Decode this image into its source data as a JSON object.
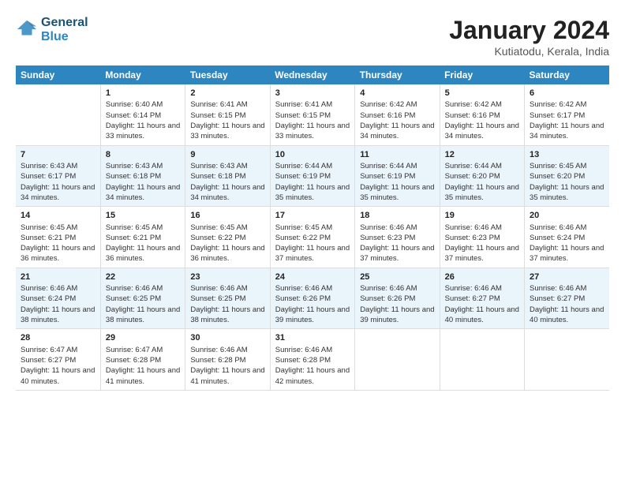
{
  "header": {
    "logo_line1": "General",
    "logo_line2": "Blue",
    "title": "January 2024",
    "subtitle": "Kutiatodu, Kerala, India"
  },
  "columns": [
    "Sunday",
    "Monday",
    "Tuesday",
    "Wednesday",
    "Thursday",
    "Friday",
    "Saturday"
  ],
  "rows": [
    [
      {
        "day": "",
        "sunrise": "",
        "sunset": "",
        "daylight": ""
      },
      {
        "day": "1",
        "sunrise": "Sunrise: 6:40 AM",
        "sunset": "Sunset: 6:14 PM",
        "daylight": "Daylight: 11 hours and 33 minutes."
      },
      {
        "day": "2",
        "sunrise": "Sunrise: 6:41 AM",
        "sunset": "Sunset: 6:15 PM",
        "daylight": "Daylight: 11 hours and 33 minutes."
      },
      {
        "day": "3",
        "sunrise": "Sunrise: 6:41 AM",
        "sunset": "Sunset: 6:15 PM",
        "daylight": "Daylight: 11 hours and 33 minutes."
      },
      {
        "day": "4",
        "sunrise": "Sunrise: 6:42 AM",
        "sunset": "Sunset: 6:16 PM",
        "daylight": "Daylight: 11 hours and 34 minutes."
      },
      {
        "day": "5",
        "sunrise": "Sunrise: 6:42 AM",
        "sunset": "Sunset: 6:16 PM",
        "daylight": "Daylight: 11 hours and 34 minutes."
      },
      {
        "day": "6",
        "sunrise": "Sunrise: 6:42 AM",
        "sunset": "Sunset: 6:17 PM",
        "daylight": "Daylight: 11 hours and 34 minutes."
      }
    ],
    [
      {
        "day": "7",
        "sunrise": "Sunrise: 6:43 AM",
        "sunset": "Sunset: 6:17 PM",
        "daylight": "Daylight: 11 hours and 34 minutes."
      },
      {
        "day": "8",
        "sunrise": "Sunrise: 6:43 AM",
        "sunset": "Sunset: 6:18 PM",
        "daylight": "Daylight: 11 hours and 34 minutes."
      },
      {
        "day": "9",
        "sunrise": "Sunrise: 6:43 AM",
        "sunset": "Sunset: 6:18 PM",
        "daylight": "Daylight: 11 hours and 34 minutes."
      },
      {
        "day": "10",
        "sunrise": "Sunrise: 6:44 AM",
        "sunset": "Sunset: 6:19 PM",
        "daylight": "Daylight: 11 hours and 35 minutes."
      },
      {
        "day": "11",
        "sunrise": "Sunrise: 6:44 AM",
        "sunset": "Sunset: 6:19 PM",
        "daylight": "Daylight: 11 hours and 35 minutes."
      },
      {
        "day": "12",
        "sunrise": "Sunrise: 6:44 AM",
        "sunset": "Sunset: 6:20 PM",
        "daylight": "Daylight: 11 hours and 35 minutes."
      },
      {
        "day": "13",
        "sunrise": "Sunrise: 6:45 AM",
        "sunset": "Sunset: 6:20 PM",
        "daylight": "Daylight: 11 hours and 35 minutes."
      }
    ],
    [
      {
        "day": "14",
        "sunrise": "Sunrise: 6:45 AM",
        "sunset": "Sunset: 6:21 PM",
        "daylight": "Daylight: 11 hours and 36 minutes."
      },
      {
        "day": "15",
        "sunrise": "Sunrise: 6:45 AM",
        "sunset": "Sunset: 6:21 PM",
        "daylight": "Daylight: 11 hours and 36 minutes."
      },
      {
        "day": "16",
        "sunrise": "Sunrise: 6:45 AM",
        "sunset": "Sunset: 6:22 PM",
        "daylight": "Daylight: 11 hours and 36 minutes."
      },
      {
        "day": "17",
        "sunrise": "Sunrise: 6:45 AM",
        "sunset": "Sunset: 6:22 PM",
        "daylight": "Daylight: 11 hours and 37 minutes."
      },
      {
        "day": "18",
        "sunrise": "Sunrise: 6:46 AM",
        "sunset": "Sunset: 6:23 PM",
        "daylight": "Daylight: 11 hours and 37 minutes."
      },
      {
        "day": "19",
        "sunrise": "Sunrise: 6:46 AM",
        "sunset": "Sunset: 6:23 PM",
        "daylight": "Daylight: 11 hours and 37 minutes."
      },
      {
        "day": "20",
        "sunrise": "Sunrise: 6:46 AM",
        "sunset": "Sunset: 6:24 PM",
        "daylight": "Daylight: 11 hours and 37 minutes."
      }
    ],
    [
      {
        "day": "21",
        "sunrise": "Sunrise: 6:46 AM",
        "sunset": "Sunset: 6:24 PM",
        "daylight": "Daylight: 11 hours and 38 minutes."
      },
      {
        "day": "22",
        "sunrise": "Sunrise: 6:46 AM",
        "sunset": "Sunset: 6:25 PM",
        "daylight": "Daylight: 11 hours and 38 minutes."
      },
      {
        "day": "23",
        "sunrise": "Sunrise: 6:46 AM",
        "sunset": "Sunset: 6:25 PM",
        "daylight": "Daylight: 11 hours and 38 minutes."
      },
      {
        "day": "24",
        "sunrise": "Sunrise: 6:46 AM",
        "sunset": "Sunset: 6:26 PM",
        "daylight": "Daylight: 11 hours and 39 minutes."
      },
      {
        "day": "25",
        "sunrise": "Sunrise: 6:46 AM",
        "sunset": "Sunset: 6:26 PM",
        "daylight": "Daylight: 11 hours and 39 minutes."
      },
      {
        "day": "26",
        "sunrise": "Sunrise: 6:46 AM",
        "sunset": "Sunset: 6:27 PM",
        "daylight": "Daylight: 11 hours and 40 minutes."
      },
      {
        "day": "27",
        "sunrise": "Sunrise: 6:46 AM",
        "sunset": "Sunset: 6:27 PM",
        "daylight": "Daylight: 11 hours and 40 minutes."
      }
    ],
    [
      {
        "day": "28",
        "sunrise": "Sunrise: 6:47 AM",
        "sunset": "Sunset: 6:27 PM",
        "daylight": "Daylight: 11 hours and 40 minutes."
      },
      {
        "day": "29",
        "sunrise": "Sunrise: 6:47 AM",
        "sunset": "Sunset: 6:28 PM",
        "daylight": "Daylight: 11 hours and 41 minutes."
      },
      {
        "day": "30",
        "sunrise": "Sunrise: 6:46 AM",
        "sunset": "Sunset: 6:28 PM",
        "daylight": "Daylight: 11 hours and 41 minutes."
      },
      {
        "day": "31",
        "sunrise": "Sunrise: 6:46 AM",
        "sunset": "Sunset: 6:28 PM",
        "daylight": "Daylight: 11 hours and 42 minutes."
      },
      {
        "day": "",
        "sunrise": "",
        "sunset": "",
        "daylight": ""
      },
      {
        "day": "",
        "sunrise": "",
        "sunset": "",
        "daylight": ""
      },
      {
        "day": "",
        "sunrise": "",
        "sunset": "",
        "daylight": ""
      }
    ]
  ]
}
